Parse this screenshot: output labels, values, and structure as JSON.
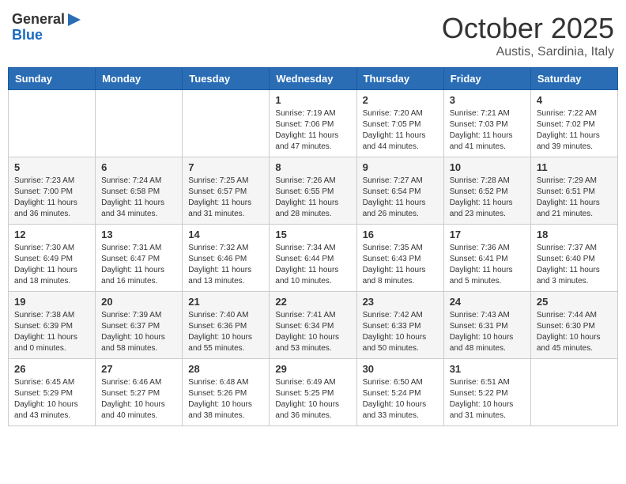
{
  "logo": {
    "general": "General",
    "blue": "Blue"
  },
  "header": {
    "month": "October 2025",
    "location": "Austis, Sardinia, Italy"
  },
  "days_of_week": [
    "Sunday",
    "Monday",
    "Tuesday",
    "Wednesday",
    "Thursday",
    "Friday",
    "Saturday"
  ],
  "weeks": [
    [
      {
        "day": "",
        "info": ""
      },
      {
        "day": "",
        "info": ""
      },
      {
        "day": "",
        "info": ""
      },
      {
        "day": "1",
        "info": "Sunrise: 7:19 AM\nSunset: 7:06 PM\nDaylight: 11 hours and 47 minutes."
      },
      {
        "day": "2",
        "info": "Sunrise: 7:20 AM\nSunset: 7:05 PM\nDaylight: 11 hours and 44 minutes."
      },
      {
        "day": "3",
        "info": "Sunrise: 7:21 AM\nSunset: 7:03 PM\nDaylight: 11 hours and 41 minutes."
      },
      {
        "day": "4",
        "info": "Sunrise: 7:22 AM\nSunset: 7:02 PM\nDaylight: 11 hours and 39 minutes."
      }
    ],
    [
      {
        "day": "5",
        "info": "Sunrise: 7:23 AM\nSunset: 7:00 PM\nDaylight: 11 hours and 36 minutes."
      },
      {
        "day": "6",
        "info": "Sunrise: 7:24 AM\nSunset: 6:58 PM\nDaylight: 11 hours and 34 minutes."
      },
      {
        "day": "7",
        "info": "Sunrise: 7:25 AM\nSunset: 6:57 PM\nDaylight: 11 hours and 31 minutes."
      },
      {
        "day": "8",
        "info": "Sunrise: 7:26 AM\nSunset: 6:55 PM\nDaylight: 11 hours and 28 minutes."
      },
      {
        "day": "9",
        "info": "Sunrise: 7:27 AM\nSunset: 6:54 PM\nDaylight: 11 hours and 26 minutes."
      },
      {
        "day": "10",
        "info": "Sunrise: 7:28 AM\nSunset: 6:52 PM\nDaylight: 11 hours and 23 minutes."
      },
      {
        "day": "11",
        "info": "Sunrise: 7:29 AM\nSunset: 6:51 PM\nDaylight: 11 hours and 21 minutes."
      }
    ],
    [
      {
        "day": "12",
        "info": "Sunrise: 7:30 AM\nSunset: 6:49 PM\nDaylight: 11 hours and 18 minutes."
      },
      {
        "day": "13",
        "info": "Sunrise: 7:31 AM\nSunset: 6:47 PM\nDaylight: 11 hours and 16 minutes."
      },
      {
        "day": "14",
        "info": "Sunrise: 7:32 AM\nSunset: 6:46 PM\nDaylight: 11 hours and 13 minutes."
      },
      {
        "day": "15",
        "info": "Sunrise: 7:34 AM\nSunset: 6:44 PM\nDaylight: 11 hours and 10 minutes."
      },
      {
        "day": "16",
        "info": "Sunrise: 7:35 AM\nSunset: 6:43 PM\nDaylight: 11 hours and 8 minutes."
      },
      {
        "day": "17",
        "info": "Sunrise: 7:36 AM\nSunset: 6:41 PM\nDaylight: 11 hours and 5 minutes."
      },
      {
        "day": "18",
        "info": "Sunrise: 7:37 AM\nSunset: 6:40 PM\nDaylight: 11 hours and 3 minutes."
      }
    ],
    [
      {
        "day": "19",
        "info": "Sunrise: 7:38 AM\nSunset: 6:39 PM\nDaylight: 11 hours and 0 minutes."
      },
      {
        "day": "20",
        "info": "Sunrise: 7:39 AM\nSunset: 6:37 PM\nDaylight: 10 hours and 58 minutes."
      },
      {
        "day": "21",
        "info": "Sunrise: 7:40 AM\nSunset: 6:36 PM\nDaylight: 10 hours and 55 minutes."
      },
      {
        "day": "22",
        "info": "Sunrise: 7:41 AM\nSunset: 6:34 PM\nDaylight: 10 hours and 53 minutes."
      },
      {
        "day": "23",
        "info": "Sunrise: 7:42 AM\nSunset: 6:33 PM\nDaylight: 10 hours and 50 minutes."
      },
      {
        "day": "24",
        "info": "Sunrise: 7:43 AM\nSunset: 6:31 PM\nDaylight: 10 hours and 48 minutes."
      },
      {
        "day": "25",
        "info": "Sunrise: 7:44 AM\nSunset: 6:30 PM\nDaylight: 10 hours and 45 minutes."
      }
    ],
    [
      {
        "day": "26",
        "info": "Sunrise: 6:45 AM\nSunset: 5:29 PM\nDaylight: 10 hours and 43 minutes."
      },
      {
        "day": "27",
        "info": "Sunrise: 6:46 AM\nSunset: 5:27 PM\nDaylight: 10 hours and 40 minutes."
      },
      {
        "day": "28",
        "info": "Sunrise: 6:48 AM\nSunset: 5:26 PM\nDaylight: 10 hours and 38 minutes."
      },
      {
        "day": "29",
        "info": "Sunrise: 6:49 AM\nSunset: 5:25 PM\nDaylight: 10 hours and 36 minutes."
      },
      {
        "day": "30",
        "info": "Sunrise: 6:50 AM\nSunset: 5:24 PM\nDaylight: 10 hours and 33 minutes."
      },
      {
        "day": "31",
        "info": "Sunrise: 6:51 AM\nSunset: 5:22 PM\nDaylight: 10 hours and 31 minutes."
      },
      {
        "day": "",
        "info": ""
      }
    ]
  ]
}
